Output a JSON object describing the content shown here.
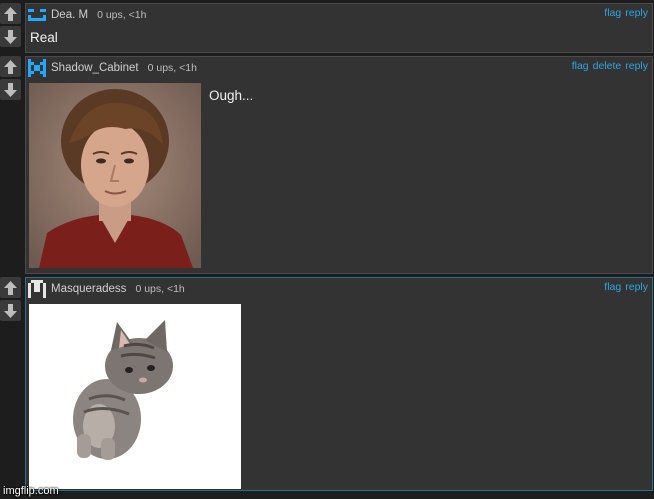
{
  "comments": [
    {
      "username": "Dea.  M",
      "meta": "0 ups, <1h",
      "actions": [
        "flag",
        "reply"
      ],
      "text": "Real",
      "avatar": "pixel-avatar-blue"
    },
    {
      "username": "Shadow_Cabinet",
      "meta": "0 ups, <1h",
      "actions": [
        "flag",
        "delete",
        "reply"
      ],
      "text": "Ough...",
      "image": "man-portrait-photo",
      "avatar": "pixel-avatar-blue"
    },
    {
      "username": "Masqueradess",
      "meta": "0 ups, <1h",
      "actions": [
        "flag",
        "reply"
      ],
      "image": "kitten-photo",
      "avatar": "pixel-avatar-white"
    }
  ],
  "watermark": "imgflip.com",
  "colors": {
    "link": "#2ea6e3",
    "panel": "#333333",
    "background": "#1d1d1d"
  }
}
